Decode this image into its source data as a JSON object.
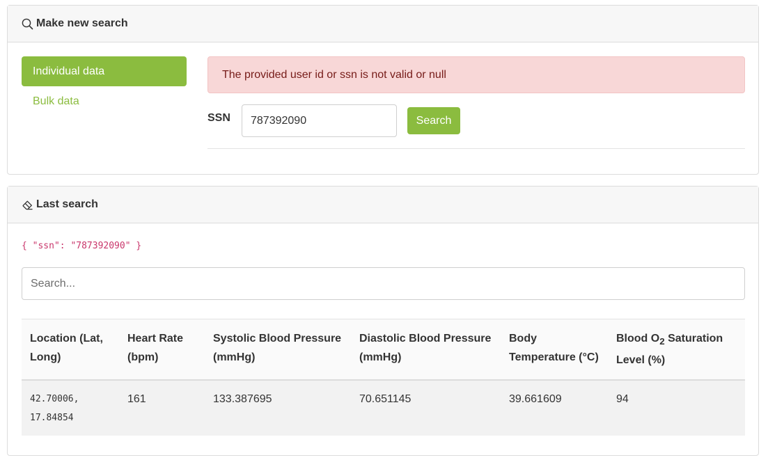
{
  "search_panel": {
    "title": "Make new search",
    "nav": {
      "individual": "Individual data",
      "bulk": "Bulk data"
    },
    "alert": "The provided user id or ssn is not valid or null",
    "ssn_label": "SSN",
    "ssn_value": "787392090",
    "search_button": "Search"
  },
  "results_panel": {
    "title": "Last search",
    "query": "{ \"ssn\": \"787392090\" }",
    "filter_placeholder": "Search...",
    "table": {
      "headers": {
        "location": "Location (Lat, Long)",
        "heart_rate": "Heart Rate (bpm)",
        "systolic": "Systolic Blood Pressure (mmHg)",
        "diastolic": "Diastolic Blood Pressure (mmHg)",
        "body_temp": "Body Temperature (°C)",
        "o2_prefix": "Blood O",
        "o2_sub": "2",
        "o2_suffix": " Saturation Level (%)"
      },
      "rows": [
        {
          "location": "42.70006, 17.84854",
          "heart_rate": "161",
          "systolic": "133.387695",
          "diastolic": "70.651145",
          "body_temp": "39.661609",
          "o2": "94"
        }
      ]
    }
  },
  "colors": {
    "accent": "#8bbc3f",
    "alert_bg": "#f8d7d7",
    "alert_text": "#761b18",
    "code": "#c9366b"
  }
}
